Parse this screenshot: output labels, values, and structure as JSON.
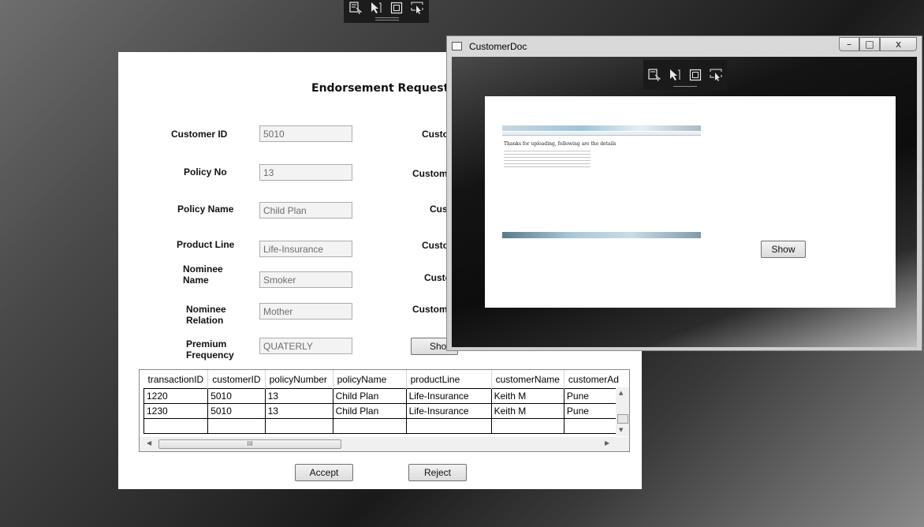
{
  "main_form": {
    "title": "Endorsement Request",
    "fields": [
      {
        "label": "Customer ID",
        "value": "5010"
      },
      {
        "label": "Policy No",
        "value": "13"
      },
      {
        "label": "Policy Name",
        "value": "Child Plan"
      },
      {
        "label": "Product Line",
        "value": "Life-Insurance"
      },
      {
        "label": "Nominee Name",
        "value": "Smoker"
      },
      {
        "label": "Nominee Relation",
        "value": "Mother"
      },
      {
        "label": "Premium Frequency",
        "value": "QUATERLY"
      }
    ],
    "right_labels_partial": [
      "Custo",
      "Custom",
      "Cus",
      "Custo",
      "Custo",
      "Custom"
    ],
    "show_button_partial": "Sho",
    "grid": {
      "columns": [
        "transactionID",
        "customerID",
        "policyNumber",
        "policyName",
        "productLine",
        "customerName",
        "customerAd"
      ],
      "rows": [
        [
          "1220",
          "5010",
          "13",
          "Child Plan",
          "Life-Insurance",
          "Keith M",
          "Pune"
        ],
        [
          "1230",
          "5010",
          "13",
          "Child Plan",
          "Life-Insurance",
          "Keith M",
          "Pune"
        ]
      ],
      "scroll_thumb_grip": "III"
    },
    "accept_label": "Accept",
    "reject_label": "Reject"
  },
  "doc_window": {
    "title": "CustomerDoc",
    "minimize_glyph": "–",
    "maximize_glyph": "□",
    "close_glyph": "x",
    "show_label": "Show",
    "thumbnail_heading": "Thanks for uploading, following are the details"
  },
  "debug_toolbar": {
    "icons": [
      "select-element-icon",
      "pointer-icon",
      "layout-bounds-icon",
      "track-focus-icon"
    ]
  },
  "colors": {
    "form_background": "#ffffff",
    "field_background": "#f3f3f3",
    "toolbar_background": "#1c1c1c"
  }
}
